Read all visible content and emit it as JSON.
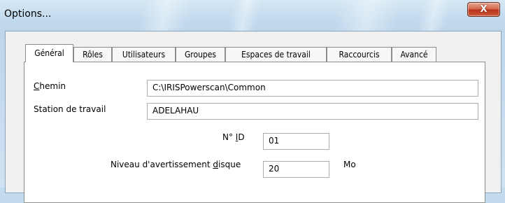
{
  "window": {
    "title": "Options...",
    "close_glyph": "X"
  },
  "tabs": [
    {
      "label": "Général",
      "active": true
    },
    {
      "label": "Rôles"
    },
    {
      "label": "Utilisateurs"
    },
    {
      "label": "Groupes"
    },
    {
      "label": "Espaces de travail"
    },
    {
      "label": "Raccourcis"
    },
    {
      "label": "Avancé"
    }
  ],
  "general": {
    "chemin": {
      "label_prefix": "",
      "label_mnemonic": "C",
      "label_rest": "hemin",
      "value": "C:\\IRISPowerscan\\Common"
    },
    "station": {
      "label": "Station de travail",
      "value": "ADELAHAU"
    },
    "id": {
      "label_prefix": "N° ",
      "label_mnemonic": "I",
      "label_rest": "D",
      "value": "01"
    },
    "disk": {
      "label_prefix": "Niveau d'avertissement ",
      "label_mnemonic": "d",
      "label_rest": "isque",
      "value": "20",
      "unit": "Mo"
    }
  }
}
